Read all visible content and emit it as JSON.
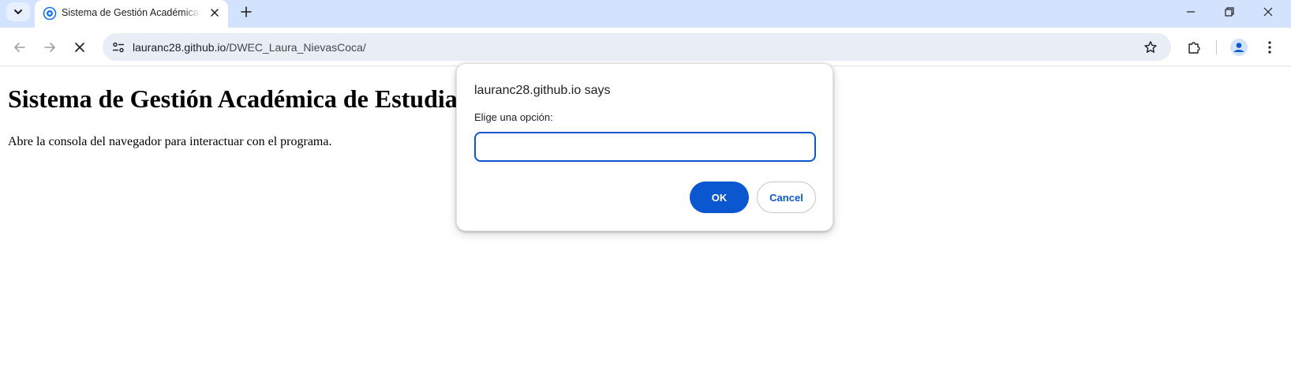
{
  "browser": {
    "tab": {
      "title": "Sistema de Gestión Académica de Estudiantes",
      "favicon": "globe-icon"
    },
    "toolbar": {
      "url_host": "lauranc28.github.io",
      "url_path": "/DWEC_Laura_NievasCoca/"
    },
    "colors": {
      "tabstrip": "#d3e3fd",
      "omnibox": "#e9eef6",
      "accent": "#0b57d0"
    }
  },
  "page": {
    "heading": "Sistema de Gestión Académica de Estudiantes",
    "instruction": "Abre la consola del navegador para interactuar con el programa."
  },
  "dialog": {
    "title": "lauranc28.github.io says",
    "message": "Elige una opción:",
    "input_value": "",
    "ok_label": "OK",
    "cancel_label": "Cancel"
  }
}
